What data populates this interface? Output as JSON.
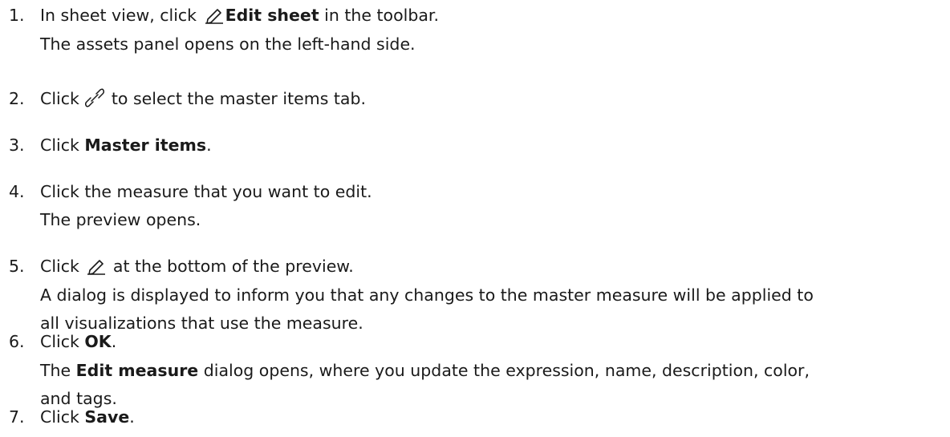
{
  "steps": [
    {
      "number": "1.",
      "line1": {
        "prefix": "In sheet view, click ",
        "icon": "edit-pencil-icon",
        "bold": "Edit sheet",
        "suffix": " in the toolbar."
      },
      "line2": "The assets panel opens on the left-hand side."
    },
    {
      "number": "2.",
      "line1": {
        "prefix": "Click ",
        "icon": "link-icon",
        "suffix": " to select the master items tab."
      }
    },
    {
      "number": "3.",
      "line1": {
        "prefix": "Click ",
        "bold": "Master items",
        "suffix": "."
      }
    },
    {
      "number": "4.",
      "line1": "Click the measure that you want to edit.",
      "line2": "The preview opens."
    },
    {
      "number": "5.",
      "line1": {
        "prefix": "Click ",
        "icon": "edit-pencil-icon",
        "suffix": " at the bottom of the preview."
      },
      "line2": "A dialog is displayed to inform you that any changes to the master measure will be applied to",
      "line3": "all visualizations that use the measure."
    },
    {
      "number": "6.",
      "line1": {
        "prefix": "Click ",
        "bold": "OK",
        "suffix": "."
      },
      "line2": {
        "prefix": "The ",
        "bold": "Edit measure",
        "suffix": " dialog opens, where you update the expression, name, description, color,"
      },
      "line3": "and tags."
    },
    {
      "number": "7.",
      "line1": {
        "prefix": "Click ",
        "bold": "Save",
        "suffix": "."
      }
    }
  ]
}
